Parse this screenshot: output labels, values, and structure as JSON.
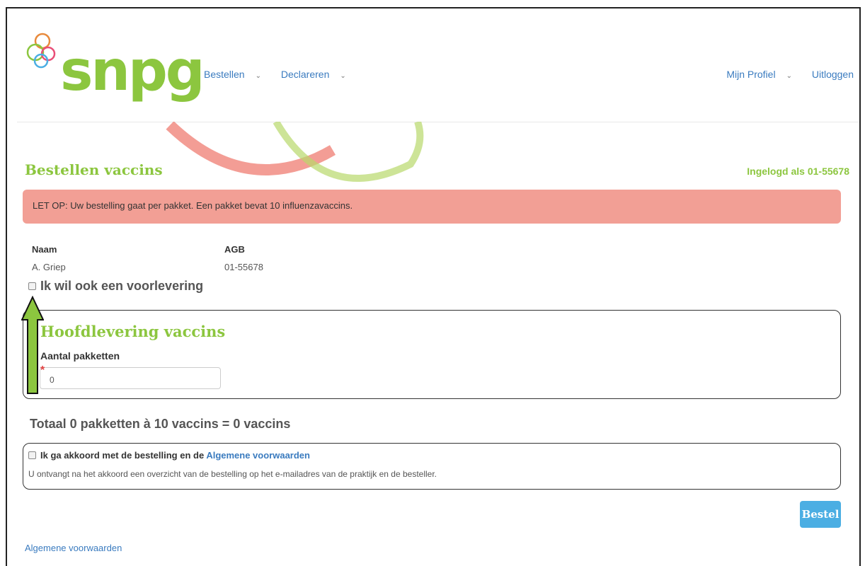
{
  "header": {
    "logo_text": "snpg",
    "nav_left": [
      "Bestellen",
      "Declareren"
    ],
    "nav_right": [
      "Mijn Profiel",
      "Uitloggen"
    ]
  },
  "page": {
    "title": "Bestellen vaccins",
    "logged_in": "Ingelogd als 01-55678"
  },
  "alert": {
    "text": "LET OP: Uw bestelling gaat per pakket. Een pakket bevat 10 influenzavaccins.",
    "color": "#f29f95"
  },
  "info": {
    "naam_label": "Naam",
    "naam_value": "A. Griep",
    "agb_label": "AGB",
    "agb_value": "01-55678"
  },
  "voorlevering": {
    "label": "Ik wil ook een voorlevering",
    "checked": false
  },
  "hoofdlevering": {
    "title": "Hoofdlevering vaccins",
    "field_label": "Aantal pakketten",
    "required_mark": "*",
    "value": "0"
  },
  "totaal": "Totaal 0 pakketten à 10 vaccins = 0 vaccins",
  "akkoord": {
    "label": "Ik ga akkoord met de bestelling en de ",
    "link": "Algemene voorwaarden",
    "info": "U ontvangt na het akkoord een overzicht van de bestelling op het e-mailadres van de praktijk en de besteller.",
    "checked": false
  },
  "actions": {
    "bestel": "Bestel"
  },
  "footer": {
    "link": "Algemene voorwaarden"
  },
  "colors": {
    "brand_green": "#8cc63f",
    "link_blue": "#3a7bbf",
    "button_blue": "#4baee3"
  }
}
